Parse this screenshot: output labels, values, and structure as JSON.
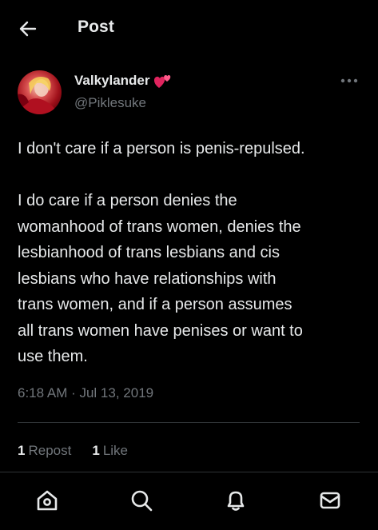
{
  "header": {
    "title": "Post",
    "back_icon": "arrow-left-icon"
  },
  "post": {
    "author": {
      "display_name": "Valkylander",
      "handle": "@Piklesuke",
      "name_badge": "two-hearts-emoji"
    },
    "text": "I don't care if a person is penis-repulsed.\n\nI do care if a person denies the\nwomanhood of trans women, denies the\nlesbianhood of trans lesbians and cis\nlesbians who have relationships with\ntrans women, and if a person assumes\nall trans women have penises or want to\nuse them.",
    "timestamp": "6:18 AM · Jul 13, 2019",
    "stats": {
      "reposts_count": "1",
      "reposts_label": "Repost",
      "likes_count": "1",
      "likes_label": "Like"
    }
  },
  "bottom_nav": {
    "items": [
      "home-icon",
      "search-icon",
      "notifications-bell-icon",
      "messages-envelope-icon"
    ]
  },
  "colors": {
    "background": "#000000",
    "text_primary": "#e7e9ea",
    "text_secondary": "#71767b",
    "divider": "#2f3336",
    "heart_emoji": "#e0245e"
  }
}
